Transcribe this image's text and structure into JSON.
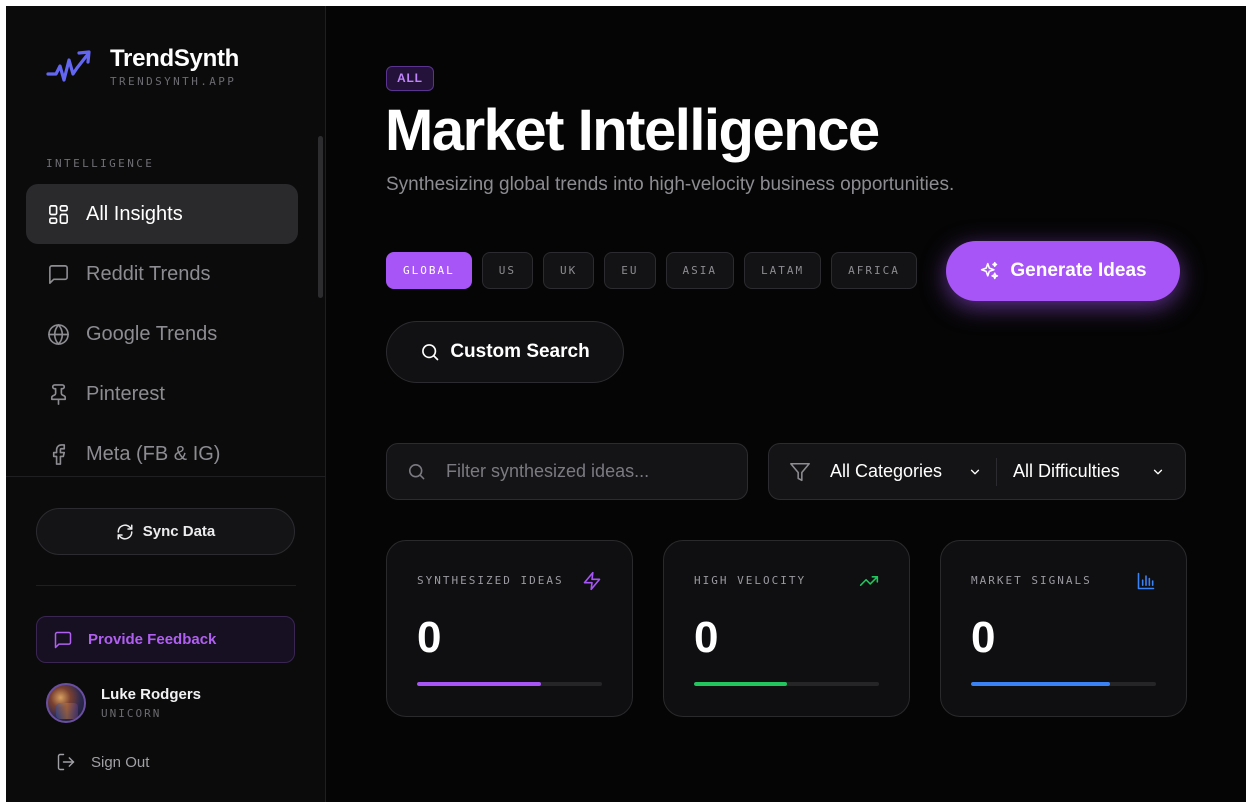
{
  "brand": {
    "name": "TrendSynth",
    "url": "TRENDSYNTH.APP"
  },
  "sidebar": {
    "section_label": "INTELLIGENCE",
    "items": [
      {
        "label": "All Insights",
        "icon": "grid-icon",
        "active": true
      },
      {
        "label": "Reddit Trends",
        "icon": "message-square-icon",
        "active": false
      },
      {
        "label": "Google Trends",
        "icon": "globe-icon",
        "active": false
      },
      {
        "label": "Pinterest",
        "icon": "pin-icon",
        "active": false
      },
      {
        "label": "Meta (FB & IG)",
        "icon": "facebook-icon",
        "active": false
      }
    ],
    "sync_label": "Sync Data",
    "feedback_label": "Provide Feedback",
    "user": {
      "name": "Luke Rodgers",
      "tier": "UNICORN"
    },
    "signout_label": "Sign Out"
  },
  "main": {
    "badge": "ALL",
    "title": "Market Intelligence",
    "subtitle": "Synthesizing global trends into high-velocity business opportunities.",
    "regions": [
      "GLOBAL",
      "US",
      "UK",
      "EU",
      "ASIA",
      "LATAM",
      "AFRICA"
    ],
    "active_region": "GLOBAL",
    "generate_label": "Generate Ideas",
    "custom_search_label": "Custom Search",
    "filter": {
      "placeholder": "Filter synthesized ideas...",
      "value": ""
    },
    "category_select": "All Categories",
    "difficulty_select": "All Difficulties",
    "stats": [
      {
        "label": "SYNTHESIZED IDEAS",
        "value": "0",
        "icon": "zap-icon",
        "color": "#a855f7",
        "progress": 0.67
      },
      {
        "label": "HIGH VELOCITY",
        "value": "0",
        "icon": "trending-up-icon",
        "color": "#22c55e",
        "progress": 0.5
      },
      {
        "label": "MARKET SIGNALS",
        "value": "0",
        "icon": "bar-chart-icon",
        "color": "#3b82f6",
        "progress": 0.75
      }
    ]
  },
  "colors": {
    "accent": "#a855f7",
    "background": "#050505",
    "sidebar": "#0b0b0c"
  }
}
